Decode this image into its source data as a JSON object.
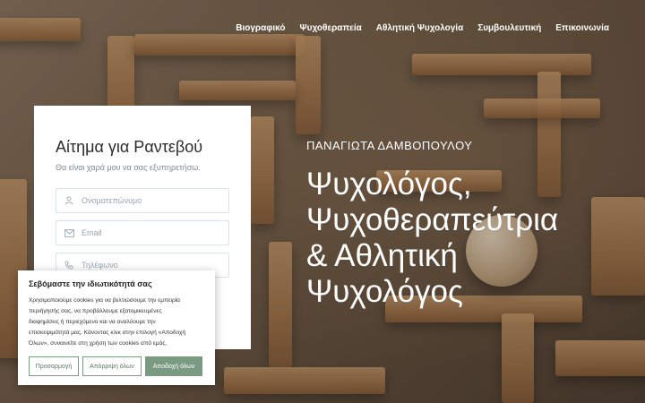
{
  "nav": {
    "items": [
      {
        "label": "Βιογραφικό"
      },
      {
        "label": "Ψυχοθεραπεία"
      },
      {
        "label": "Αθλητική Ψυχολογία"
      },
      {
        "label": "Συμβουλευτική"
      },
      {
        "label": "Επικοινωνία"
      }
    ]
  },
  "hero": {
    "name": "ΠΑΝΑΓΙΩΤΑ ΔΑΜΒΟΠΟΥΛΟΥ",
    "title_lines": [
      "Ψυχολόγος,",
      "Ψυχοθεραπεύτρια",
      "& Αθλητική",
      "Ψυχολόγος"
    ]
  },
  "form": {
    "title": "Αίτημα για Ραντεβού",
    "subtitle": "Θα είναι χαρά μου να σας εξυπηρετήσω.",
    "fields": {
      "name_placeholder": "Ονοματεπώνυμο",
      "email_placeholder": "Email",
      "phone_placeholder": "Τηλέφωνο"
    }
  },
  "cookie": {
    "title": "Σεβόμαστε την ιδιωτικότητά σας",
    "body_lines": [
      "Χρησιμοποιούμε cookies για να βελτιώσουμε την εμπειρία",
      "περιήγησής σας, να προβάλλουμε εξατομικευμένες",
      "διαφημίσεις ή περιεχόμενο και να αναλύουμε την",
      "επισκεψιμότητά μας. Κάνοντας κλικ στην επιλογή «Αποδοχή",
      "Όλων», συναινείτε στη χρήση των cookies από εμάς."
    ],
    "customize_label": "Προσαρμογή",
    "reject_label": "Απόρριψη όλων",
    "accept_label": "Αποδοχή όλων"
  },
  "colors": {
    "accent": "#7a9a82"
  }
}
